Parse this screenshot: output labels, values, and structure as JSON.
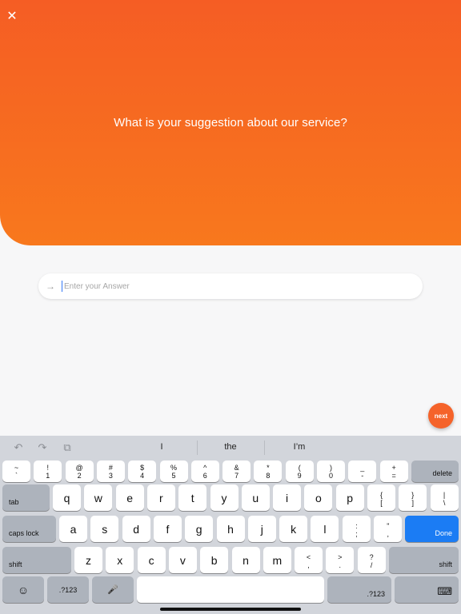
{
  "header": {
    "close_glyph": "✕",
    "question": "What is your suggestion about our service?"
  },
  "answer": {
    "arrow_glyph": "→",
    "placeholder": "Enter your Answer",
    "value": ""
  },
  "next_label": "next",
  "keyboard": {
    "suggestions": [
      "I",
      "the",
      "I’m"
    ],
    "toolbar_glyphs": {
      "undo": "↶",
      "redo": "↷",
      "paste": "⧉"
    },
    "row_numbers": [
      {
        "top": "~",
        "bottom": "`"
      },
      {
        "top": "!",
        "bottom": "1"
      },
      {
        "top": "@",
        "bottom": "2"
      },
      {
        "top": "#",
        "bottom": "3"
      },
      {
        "top": "$",
        "bottom": "4"
      },
      {
        "top": "%",
        "bottom": "5"
      },
      {
        "top": "^",
        "bottom": "6"
      },
      {
        "top": "&",
        "bottom": "7"
      },
      {
        "top": "*",
        "bottom": "8"
      },
      {
        "top": "(",
        "bottom": "9"
      },
      {
        "top": ")",
        "bottom": "0"
      },
      {
        "top": "_",
        "bottom": "-"
      },
      {
        "top": "+",
        "bottom": "="
      }
    ],
    "delete_label": "delete",
    "tab_label": "tab",
    "row_top": [
      "q",
      "w",
      "e",
      "r",
      "t",
      "y",
      "u",
      "i",
      "o",
      "p"
    ],
    "row_top_extra": [
      {
        "top": "{",
        "bottom": "["
      },
      {
        "top": "}",
        "bottom": "]"
      },
      {
        "top": "|",
        "bottom": "\\"
      }
    ],
    "caps_label": "caps lock",
    "row_home": [
      "a",
      "s",
      "d",
      "f",
      "g",
      "h",
      "j",
      "k",
      "l"
    ],
    "row_home_extra": [
      {
        "top": ":",
        "bottom": ";"
      },
      {
        "top": "\"",
        "bottom": ","
      }
    ],
    "done_label": "Done",
    "shift_label": "shift",
    "row_bottom": [
      "z",
      "x",
      "c",
      "v",
      "b",
      "n",
      "m"
    ],
    "row_bottom_extra": [
      {
        "top": "<",
        "bottom": ","
      },
      {
        "top": ">",
        "bottom": "."
      },
      {
        "top": "?",
        "bottom": "/"
      }
    ],
    "emoji_glyph": "☺",
    "numbers_label": ".?123",
    "mic_glyph": "🎤",
    "hide_glyph": "⌨"
  }
}
